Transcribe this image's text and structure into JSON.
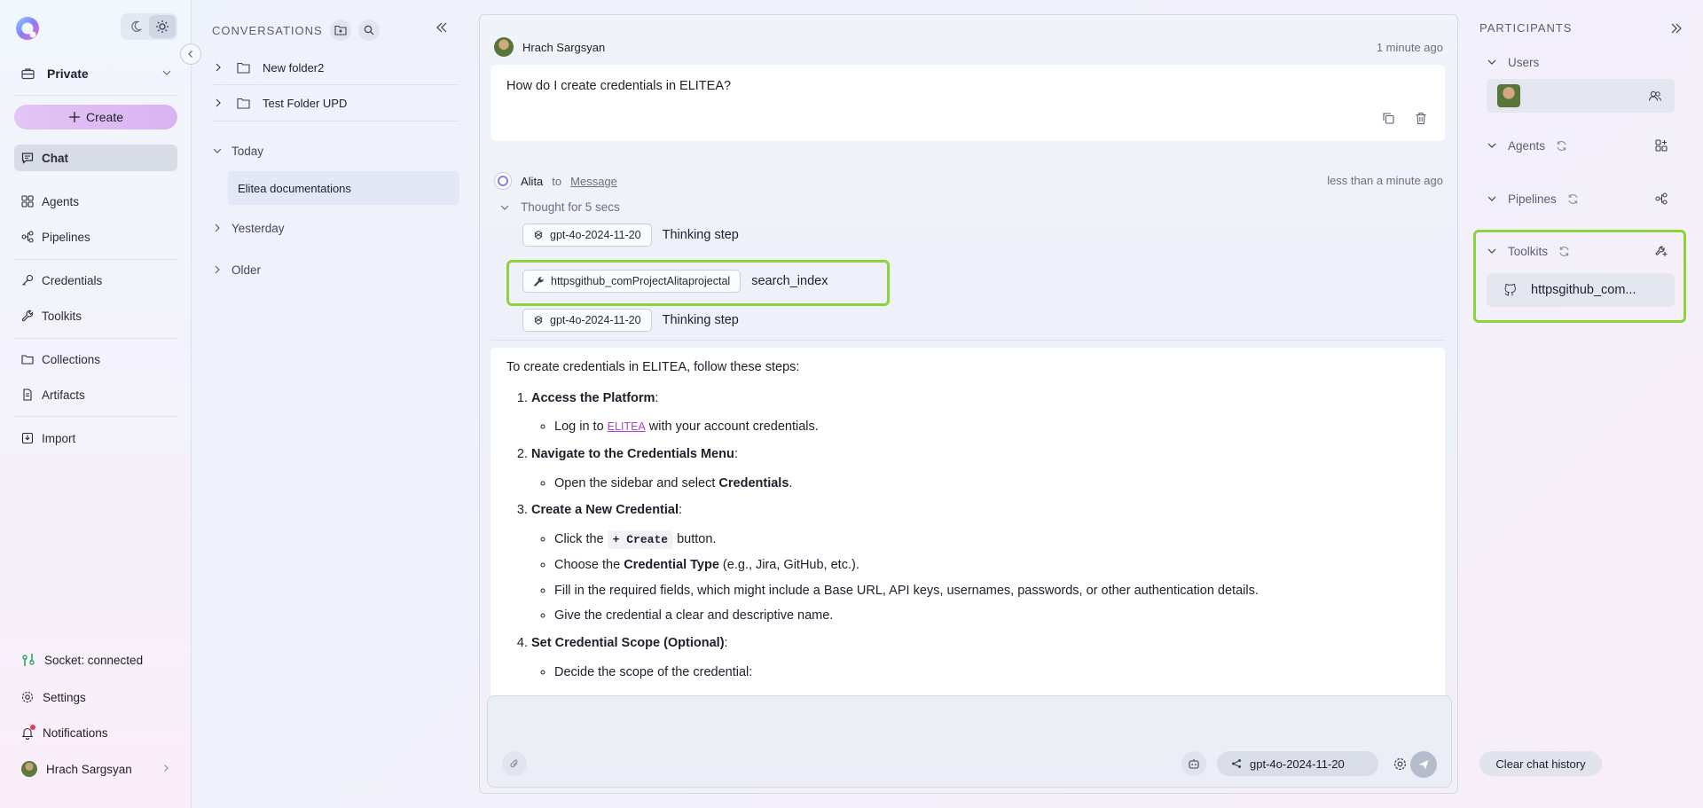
{
  "sidebar": {
    "project": "Private",
    "create_label": "Create",
    "nav": [
      {
        "label": "Chat",
        "icon": "chat-icon"
      },
      {
        "label": "Agents",
        "icon": "agents-icon"
      },
      {
        "label": "Pipelines",
        "icon": "pipelines-icon"
      },
      {
        "label": "Credentials",
        "icon": "key-icon"
      },
      {
        "label": "Toolkits",
        "icon": "wrench-icon"
      },
      {
        "label": "Collections",
        "icon": "folder-icon"
      },
      {
        "label": "Artifacts",
        "icon": "file-icon"
      },
      {
        "label": "Import",
        "icon": "import-icon"
      }
    ],
    "socket_status": "Socket: connected",
    "settings_label": "Settings",
    "notifications_label": "Notifications",
    "user_name": "Hrach Sargsyan"
  },
  "conversations": {
    "title": "CONVERSATIONS",
    "folders": [
      "New folder2",
      "Test Folder UPD"
    ],
    "groups": {
      "today": "Today",
      "yesterday": "Yesterday",
      "older": "Older"
    },
    "today_items": [
      "Elitea documentations"
    ]
  },
  "chat": {
    "user_message": {
      "author": "Hrach Sargsyan",
      "time": "1 minute ago",
      "text": "How do I create credentials in ELITEA?"
    },
    "ai_message": {
      "author": "Alita",
      "to_label": "to",
      "target": "Message",
      "time": "less than a minute ago",
      "thought": "Thought for 5 secs",
      "steps": [
        {
          "chip": "gpt-4o-2024-11-20",
          "label": "Thinking step"
        },
        {
          "chip": "httpsgithub_comProjectAlitaprojectal",
          "label": "search_index"
        },
        {
          "chip": "gpt-4o-2024-11-20",
          "label": "Thinking step"
        }
      ],
      "answer": {
        "intro": "To create credentials in ELITEA, follow these steps:",
        "s1_title": "Access the Platform",
        "s1_b1_pre": "Log in to ",
        "s1_b1_link": "ELITEA",
        "s1_b1_post": " with your account credentials.",
        "s2_title": "Navigate to the Credentials Menu",
        "s2_b1_pre": "Open the sidebar and select ",
        "s2_b1_bold": "Credentials",
        "s2_b1_post": ".",
        "s3_title": "Create a New Credential",
        "s3_b1_pre": "Click the ",
        "s3_b1_code": "+ Create",
        "s3_b1_post": " button.",
        "s3_b2_pre": "Choose the ",
        "s3_b2_bold": "Credential Type",
        "s3_b2_post": " (e.g., Jira, GitHub, etc.).",
        "s3_b3": "Fill in the required fields, which might include a Base URL, API keys, usernames, passwords, or other authentication details.",
        "s3_b4": "Give the credential a clear and descriptive name.",
        "s4_title": "Set Credential Scope (Optional)",
        "s4_b1": "Decide the scope of the credential:"
      }
    },
    "input": {
      "model": "gpt-4o-2024-11-20"
    }
  },
  "participants": {
    "title": "PARTICIPANTS",
    "sections": {
      "users": "Users",
      "agents": "Agents",
      "pipelines": "Pipelines",
      "toolkits": "Toolkits"
    },
    "toolkit_item": "httpsgithub_com...",
    "clear_label": "Clear chat history"
  },
  "colors": {
    "highlight": "#8dd43b",
    "link": "#b043c7",
    "create_button": "#dcb7f2"
  }
}
